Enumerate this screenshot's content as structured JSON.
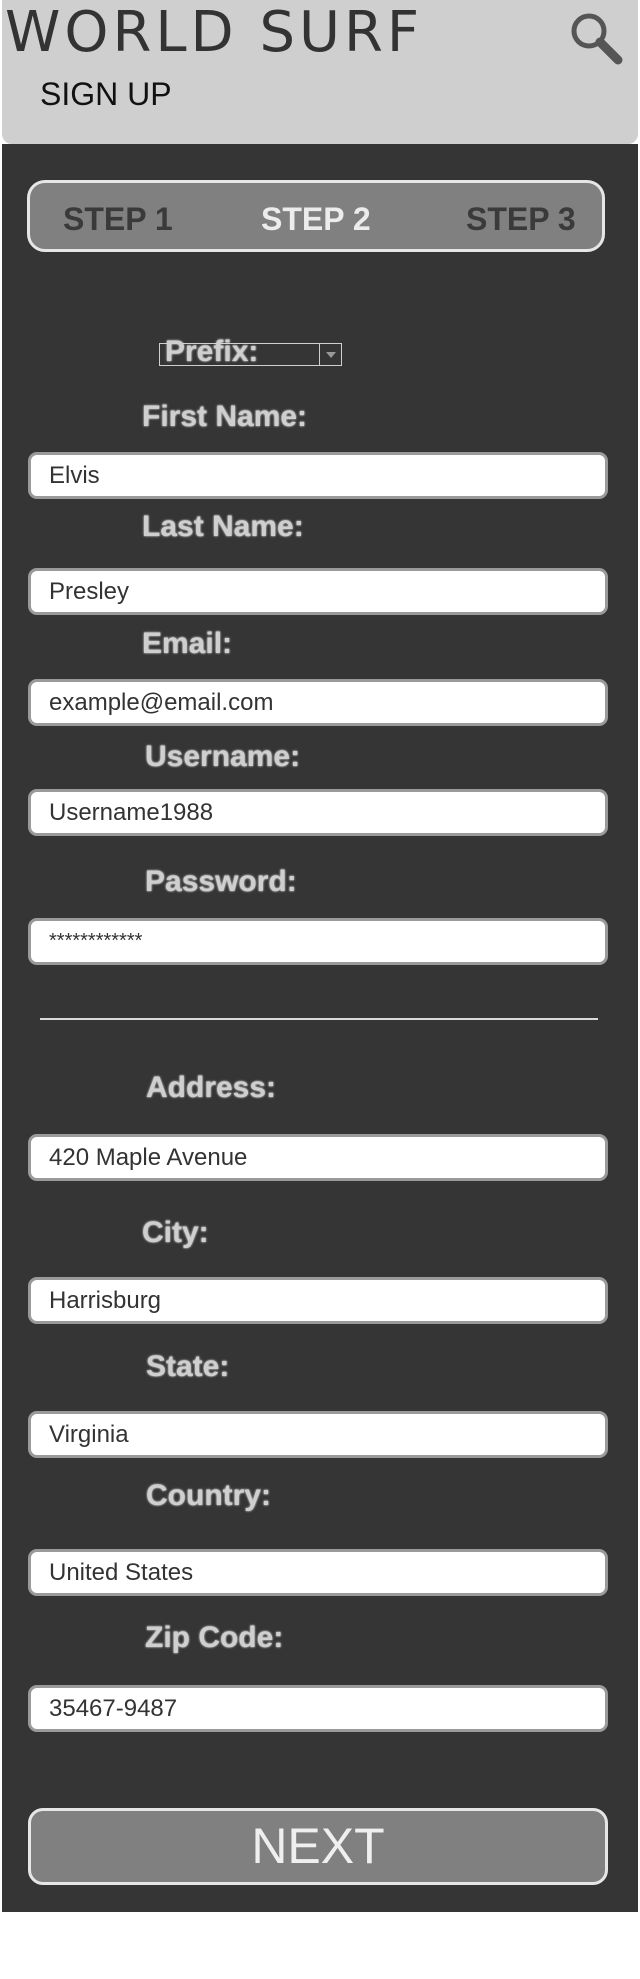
{
  "header": {
    "brand": "WORLD SURF",
    "subtitle": "SIGN UP",
    "search_icon": "search-icon"
  },
  "steps": [
    "STEP 1",
    "STEP 2",
    "STEP 3"
  ],
  "form": {
    "prefix_label": "Prefix:",
    "first_name_label": "First Name:",
    "first_name_value": "Elvis",
    "last_name_label": "Last Name:",
    "last_name_value": "Presley",
    "email_label": "Email:",
    "email_value": "example@email.com",
    "username_label": "Username:",
    "username_value": "Username1988",
    "password_label": "Password:",
    "password_value": "************",
    "address_label": "Address:",
    "address_value": "420 Maple Avenue",
    "city_label": "City:",
    "city_value": "Harrisburg",
    "state_label": "State:",
    "state_value": "Virginia",
    "country_label": "Country:",
    "country_value": "United States",
    "zip_label": "Zip Code:",
    "zip_value": "35467-9487"
  },
  "next_label": "NEXT",
  "colors": {
    "header_bg": "#cfcfcf",
    "panel_bg": "#353535",
    "step_bar_bg": "#808080",
    "label_text": "#cfcfcf"
  }
}
